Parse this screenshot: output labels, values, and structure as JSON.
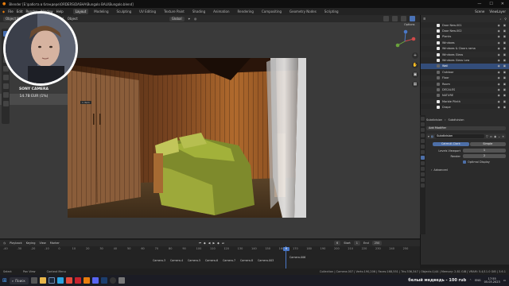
{
  "window": {
    "title": "Blender [E:\\работа в блэндере\\ORDERS\\DASHA\\Bungalo BALI\\Bungalo.blend]",
    "controls": [
      "—",
      "☐",
      "✕"
    ]
  },
  "menubar": {
    "menus": [
      "File",
      "Edit",
      "Render",
      "Window",
      "Help"
    ],
    "workspaces": [
      "Layout",
      "Modeling",
      "Sculpting",
      "UV Editing",
      "Texture Paint",
      "Shading",
      "Animation",
      "Rendering",
      "Compositing",
      "Geometry Nodes",
      "Scripting"
    ],
    "active_workspace": "Layout",
    "scene": "Scene",
    "view_layer": "ViewLayer"
  },
  "viewport_header": {
    "mode": "Object Mode",
    "menus": [
      "View",
      "Select",
      "Add",
      "Object"
    ],
    "orientation": "Global",
    "options": "Options"
  },
  "camera_info": {
    "title": "SONY CAMERA",
    "price": "14.7В EUR (1%)",
    "popup": "1 item"
  },
  "outliner": {
    "rows": [
      {
        "label": "Door New.001",
        "type": "mesh",
        "selected": false
      },
      {
        "label": "Door New.002",
        "type": "mesh",
        "selected": false
      },
      {
        "label": "Planks",
        "type": "mesh",
        "selected": false
      },
      {
        "label": "Windows",
        "type": "mesh",
        "selected": false
      },
      {
        "label": "Windows & Cloors rama",
        "type": "mesh",
        "selected": false
      },
      {
        "label": "Windows Glass",
        "type": "mesh",
        "selected": false
      },
      {
        "label": "Windows Glass Low",
        "type": "mesh",
        "selected": false
      },
      {
        "label": "Wall",
        "type": "collection",
        "selected": true
      },
      {
        "label": "Outdoor",
        "type": "collection",
        "selected": false
      },
      {
        "label": "Floor",
        "type": "collection",
        "selected": false
      },
      {
        "label": "Room",
        "type": "collection",
        "selected": false
      },
      {
        "label": "DECALES",
        "type": "collection",
        "selected": false
      },
      {
        "label": "NATURE",
        "type": "collection",
        "selected": false
      },
      {
        "label": "Marble Plinth",
        "type": "mesh",
        "selected": false
      },
      {
        "label": "Drape",
        "type": "mesh",
        "selected": false
      },
      {
        "label": "Marble Leaves",
        "type": "mesh",
        "selected": false
      }
    ]
  },
  "properties": {
    "object": "Subdivision",
    "breadcrumb": "Subdivision",
    "add_modifier": "Add Modifier",
    "modifier_name": "Subdivision",
    "tabs": [
      "Catmull-Clark",
      "Simple"
    ],
    "levels_viewport_label": "Levels Viewport",
    "levels_viewport": "1",
    "render_label": "Render",
    "render_value": "2",
    "optimal_display": "Optimal Display",
    "advanced": "Advanced"
  },
  "timeline": {
    "menus": [
      "Playback",
      "Keying",
      "View",
      "Marker"
    ],
    "current_frame": "6",
    "start_label": "Start",
    "start": "1",
    "end_label": "End",
    "end": "250",
    "ticks": [
      "-40",
      "-30",
      "-20",
      "-10",
      "0",
      "10",
      "20",
      "30",
      "40",
      "50",
      "60",
      "70",
      "80",
      "90",
      "100",
      "110",
      "120",
      "130",
      "140",
      "150",
      "160",
      "170",
      "180",
      "190",
      "200",
      "210",
      "220",
      "230",
      "240",
      "250"
    ],
    "markers": [
      "Camera.3",
      "Camera.4",
      "Camera.5",
      "Camera.6",
      "Camera.7",
      "Camera.8",
      "Camera.003",
      "Camera.006"
    ]
  },
  "statusbar": {
    "items": [
      "Select",
      "Pan View",
      "Context Menu"
    ],
    "stats": "Collection | Camera.007 | Verts:190,206 | Faces:168,551 | Tris:336,347 | Objects:1/44 | Memory: 2.81 GiB | VRAM: 5.4/11.0 GiB | 3.6.1"
  },
  "taskbar": {
    "search": "Поиск",
    "promo": "белый медведь - 100 rub",
    "language": "ENG",
    "time": "17:55",
    "date": "05.03.2023"
  },
  "colors": {
    "accent": "#4a78c7",
    "selected_row": "#334d7a",
    "panel_bg": "#2b2b2b"
  }
}
